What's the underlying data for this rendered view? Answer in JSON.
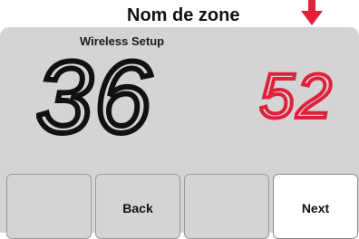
{
  "callout": {
    "label": "Nom de zone"
  },
  "screen": {
    "title": "Wireless Setup",
    "main_value": "36",
    "zone_value": "52"
  },
  "softkeys": [
    {
      "label": ""
    },
    {
      "label": "Back"
    },
    {
      "label": ""
    },
    {
      "label": "Next"
    }
  ],
  "colors": {
    "lcd_background": "#d4d4d4",
    "digit_main": "#111111",
    "digit_zone": "#e0213c",
    "arrow": "#e0213c"
  },
  "icons": [
    "down-arrow-icon"
  ]
}
